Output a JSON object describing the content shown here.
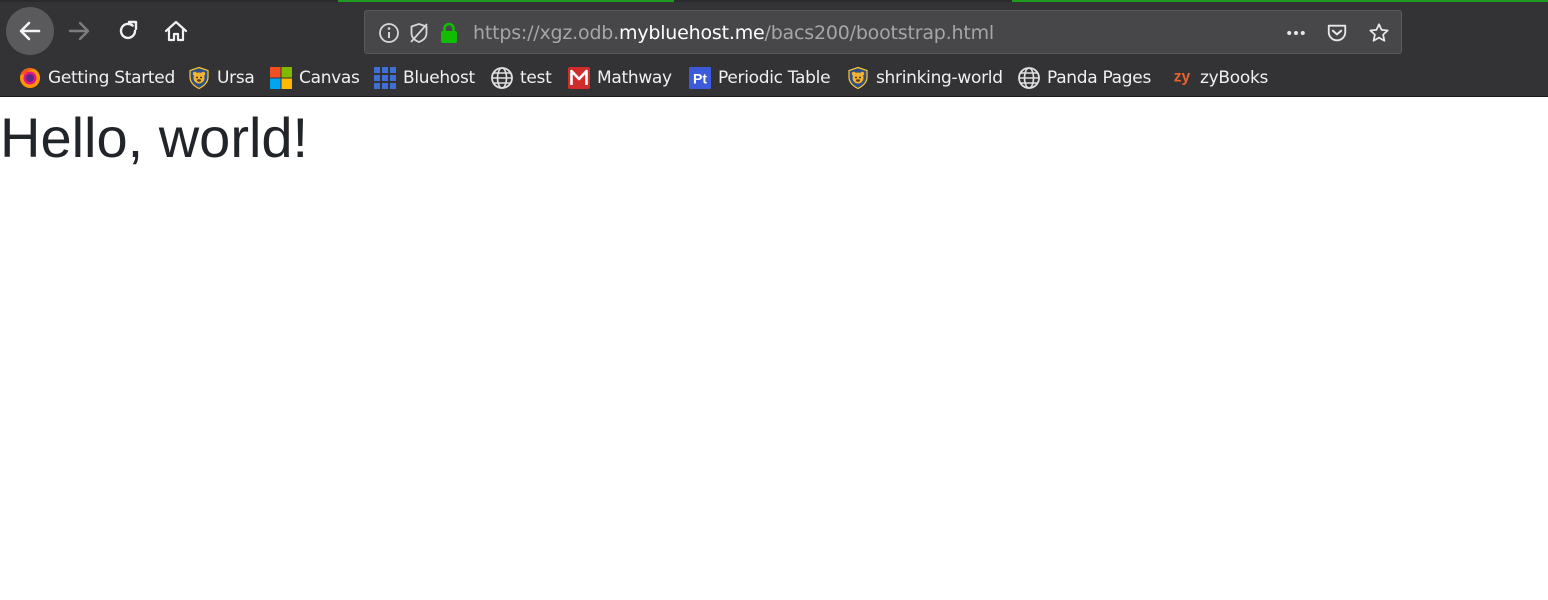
{
  "browser": {
    "url": {
      "prefix": "https://xgz.odb.",
      "host": "mybluehost.me",
      "path": "/bacs200/bootstrap.html"
    },
    "icons": {
      "back": "back-arrow-icon",
      "forward": "forward-arrow-icon",
      "reload": "reload-icon",
      "home": "home-icon",
      "info": "info-icon",
      "tracking": "tracking-protection-icon",
      "lock": "lock-icon",
      "more": "more-icon",
      "pocket": "pocket-icon",
      "bookmark_star": "star-icon"
    },
    "colors": {
      "chrome_bg": "#333336",
      "urlbar_bg": "#474749",
      "lock_green": "#12bc00",
      "accent_green": "#1f9a1f"
    }
  },
  "bookmarks": [
    {
      "label": "Getting Started",
      "icon": "firefox-icon"
    },
    {
      "label": "Ursa",
      "icon": "bear-shield-icon"
    },
    {
      "label": "Canvas",
      "icon": "windows-logo-icon"
    },
    {
      "label": "Bluehost",
      "icon": "grid-icon"
    },
    {
      "label": "test",
      "icon": "globe-icon"
    },
    {
      "label": "Mathway",
      "icon": "mathway-icon"
    },
    {
      "label": "Periodic Table",
      "icon": "pt-icon"
    },
    {
      "label": "shrinking-world",
      "icon": "bear-shield-icon"
    },
    {
      "label": "Panda Pages",
      "icon": "globe-icon"
    },
    {
      "label": "zyBooks",
      "icon": "zy-icon"
    }
  ],
  "page": {
    "headline": "Hello, world!"
  }
}
